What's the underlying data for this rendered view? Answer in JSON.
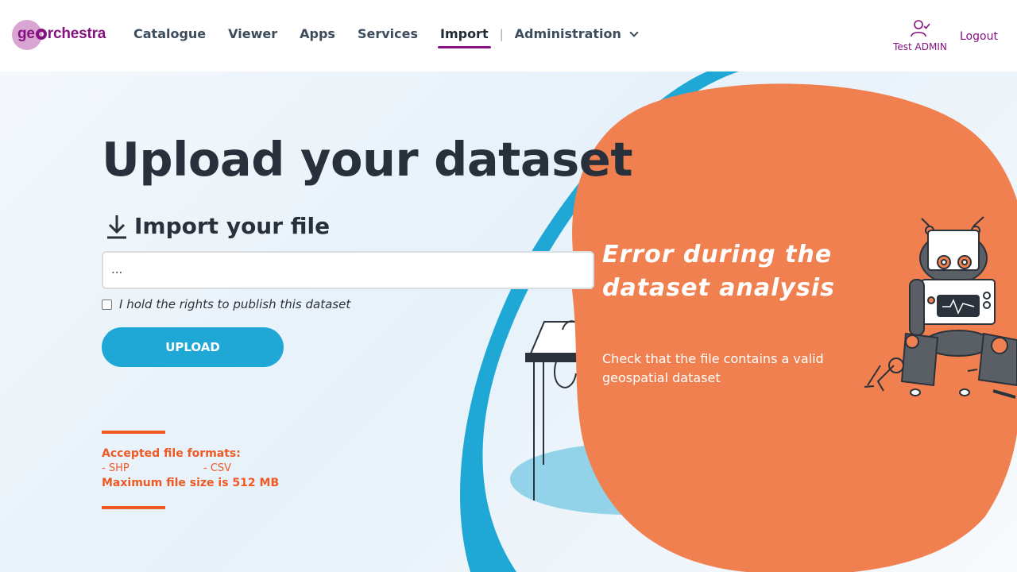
{
  "app": {
    "logo_prefix": "ge",
    "logo_suffix": "rchestra"
  },
  "nav": {
    "items": [
      {
        "label": "Catalogue"
      },
      {
        "label": "Viewer"
      },
      {
        "label": "Apps"
      },
      {
        "label": "Services"
      },
      {
        "label": "Import"
      }
    ],
    "separator": "|",
    "admin_label": "Administration",
    "active": "Import"
  },
  "user": {
    "name": "Test ADMIN",
    "logout_label": "Logout"
  },
  "upload": {
    "title": "Upload your dataset",
    "section_title": "Import your file",
    "file_value": "...",
    "rights_label": "I hold the rights to publish this dataset",
    "rights_checked": false,
    "button_label": "UPLOAD"
  },
  "formats": {
    "heading": "Accepted file formats:",
    "list": [
      "- SHP",
      "- CSV"
    ],
    "max_size": "Maximum file size is 512 MB"
  },
  "error": {
    "title": "Error during the dataset analysis",
    "message": "Check that the file contains a valid geospatial dataset"
  },
  "colors": {
    "brand": "#85127e",
    "accent_blue": "#1fa8d6",
    "accent_orange": "#ef5a24",
    "blob": "#f08050"
  }
}
